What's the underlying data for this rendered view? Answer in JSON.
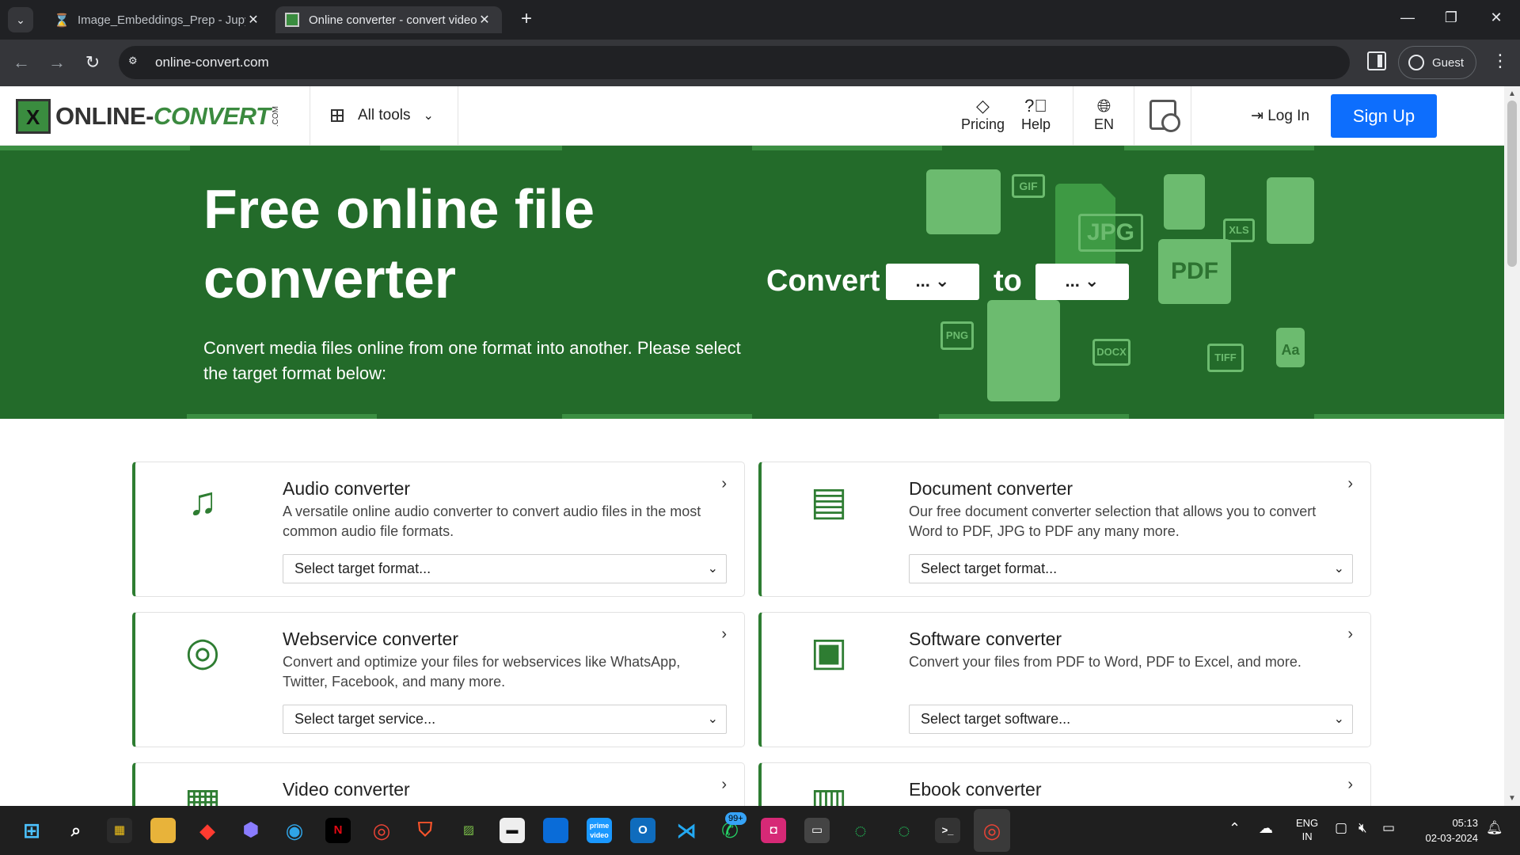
{
  "browser": {
    "tabs": [
      {
        "title": "Image_Embeddings_Prep - Jupyter",
        "close": "✕"
      },
      {
        "title": "Online converter - convert video",
        "close": "✕"
      }
    ],
    "new_tab": "+",
    "url": "online-convert.com",
    "profile": "Guest",
    "window_controls": [
      "—",
      "❐",
      "✕"
    ]
  },
  "header": {
    "logo_text": "ONLINE-",
    "logo_text_accent": "CONVERT",
    "logo_suffix": ".COM",
    "all_tools": "All tools",
    "pricing": "Pricing",
    "help": "Help",
    "language": "EN",
    "login": "Log In",
    "signup": "Sign Up"
  },
  "hero": {
    "title": "Free online file converter",
    "subtitle": "Convert media files online from one format into another. Please select the target format below:",
    "convert_label": "Convert",
    "to_label": "to",
    "from_select": "...",
    "to_select": "...",
    "file_tags": [
      "GIF",
      "JPG",
      "XLS",
      "PDF",
      "PNG",
      "DOCX",
      "TIFF",
      "Aa"
    ]
  },
  "cards": [
    {
      "title": "Audio converter",
      "desc": "A versatile online audio converter to convert audio files in the most common audio file formats.",
      "select": "Select target format...",
      "icon": "music-note-icon"
    },
    {
      "title": "Document converter",
      "desc": "Our free document converter selection that allows you to convert Word to PDF, JPG to PDF any many more.",
      "select": "Select target format...",
      "icon": "document-icon"
    },
    {
      "title": "Webservice converter",
      "desc": "Convert and optimize your files for webservices like WhatsApp, Twitter, Facebook, and many more.",
      "select": "Select target service...",
      "icon": "globe-icon"
    },
    {
      "title": "Software converter",
      "desc": "Convert your files from PDF to Word, PDF to Excel, and more.",
      "select": "Select target software...",
      "icon": "computer-icon"
    },
    {
      "title": "Video converter",
      "desc": "",
      "select": "",
      "icon": "film-icon"
    },
    {
      "title": "Ebook converter",
      "desc": "",
      "select": "",
      "icon": "books-icon"
    }
  ],
  "taskbar": {
    "whatsapp_badge": "99+",
    "lang_top": "ENG",
    "lang_bottom": "IN",
    "time": "05:13",
    "date": "02-03-2024"
  },
  "colors": {
    "brand_green": "#236b2a",
    "accent_green": "#2e7d32",
    "signup_blue": "#0d6efd"
  }
}
